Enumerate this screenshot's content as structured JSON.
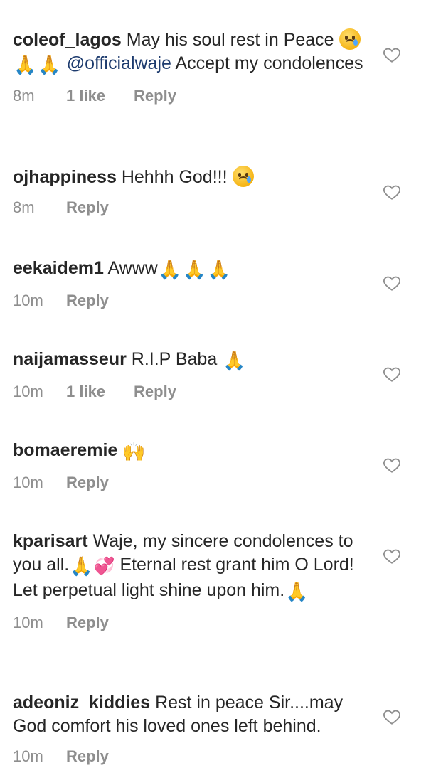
{
  "comments": [
    {
      "username": "coleof_lagos",
      "text_a": "May his soul rest in Peace",
      "mention": "@officialwaje",
      "text_b": "Accept my condolences",
      "time": "8m",
      "likes": "1 like",
      "reply": "Reply"
    },
    {
      "username": "ojhappiness",
      "text": "Hehhh God!!!",
      "time": "8m",
      "reply": "Reply"
    },
    {
      "username": "eekaidem1",
      "text": "Awww",
      "time": "10m",
      "reply": "Reply"
    },
    {
      "username": "naijamasseur",
      "text": "R.I.P Baba",
      "time": "10m",
      "likes": "1 like",
      "reply": "Reply"
    },
    {
      "username": "bomaeremie",
      "text": "",
      "time": "10m",
      "reply": "Reply"
    },
    {
      "username": "kparisart",
      "text_a": "Waje, my sincere condolences to you all.",
      "text_b": "Eternal rest grant him O Lord! Let perpetual light shine upon him.",
      "time": "10m",
      "reply": "Reply"
    },
    {
      "username": "adeoniz_kiddies",
      "text": "Rest in peace Sir....may God comfort his loved ones left behind.",
      "time": "10m",
      "reply": "Reply"
    }
  ],
  "icons": {
    "like": "heart-outline-icon",
    "sad": "crying-face-emoji",
    "pray": "folded-hands-emoji",
    "raise": "raising-hands-emoji",
    "hearts": "revolving-hearts-emoji"
  }
}
